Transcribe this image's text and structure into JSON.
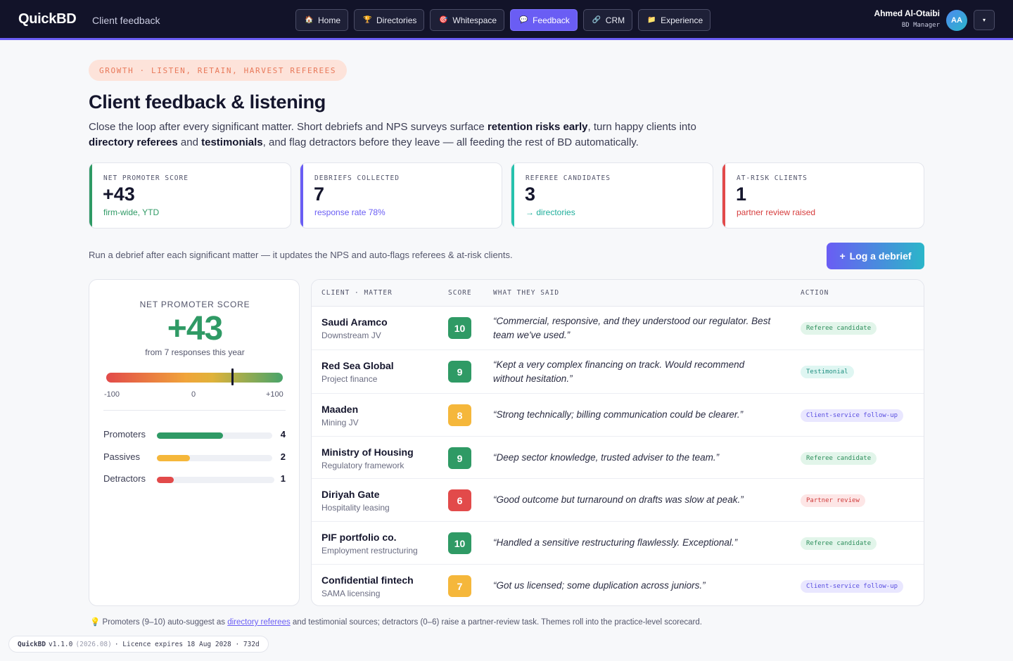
{
  "header": {
    "brand": "QuickBD",
    "section": "Client feedback",
    "nav": [
      {
        "label": "Home",
        "icon": "🏠",
        "active": false
      },
      {
        "label": "Directories",
        "icon": "🏆",
        "active": false
      },
      {
        "label": "Whitespace",
        "icon": "🎯",
        "active": false
      },
      {
        "label": "Feedback",
        "icon": "💬",
        "active": true
      },
      {
        "label": "CRM",
        "icon": "🔗",
        "active": false
      },
      {
        "label": "Experience",
        "icon": "📁",
        "active": false
      }
    ],
    "user": {
      "name": "Ahmed Al-Otaibi",
      "role": "BD Manager",
      "initials": "AA",
      "menu_icon": "▾"
    }
  },
  "hero": {
    "eyebrow": "GROWTH · LISTEN, RETAIN, HARVEST REFEREES",
    "title": "Client feedback & listening",
    "desc_parts": [
      {
        "t": "Close the loop after every significant matter. Short debriefs and NPS surveys surface ",
        "b": false
      },
      {
        "t": "retention risks early",
        "b": true
      },
      {
        "t": ", turn happy clients into ",
        "b": false
      },
      {
        "t": "directory referees",
        "b": true
      },
      {
        "t": " and ",
        "b": false
      },
      {
        "t": "testimonials",
        "b": true
      },
      {
        "t": ", and flag detractors before they leave — all feeding the rest of BD automatically.",
        "b": false
      }
    ]
  },
  "kpis": [
    {
      "label": "NET PROMOTER SCORE",
      "value": "+43",
      "sub": "firm-wide, YTD",
      "tone": "green"
    },
    {
      "label": "DEBRIEFS COLLECTED",
      "value": "7",
      "sub": "response rate 78%",
      "tone": "purple"
    },
    {
      "label": "REFEREE CANDIDATES",
      "value": "3",
      "sub": "→ directories",
      "tone": "teal"
    },
    {
      "label": "AT-RISK CLIENTS",
      "value": "1",
      "sub": "partner review raised",
      "tone": "red"
    }
  ],
  "actions": {
    "hint": "Run a debrief after each significant matter — it updates the NPS and auto-flags referees & at-risk clients.",
    "log_button": "Log a debrief",
    "log_icon": "+"
  },
  "nps": {
    "label": "NET PROMOTER SCORE",
    "score": "+43",
    "score_value": 43,
    "responses": "from 7 responses this year",
    "min": -100,
    "max": 100,
    "ticks": [
      "-100",
      "0",
      "+100"
    ],
    "distribution": [
      {
        "label": "Promoters",
        "count": 4,
        "color": "#2f9a65"
      },
      {
        "label": "Passives",
        "count": 2,
        "color": "#f5b73b"
      },
      {
        "label": "Detractors",
        "count": 1,
        "color": "#e24a4a"
      }
    ],
    "distribution_total": 7
  },
  "table": {
    "headers": {
      "client": "CLIENT · MATTER",
      "score": "SCORE",
      "said": "WHAT THEY SAID",
      "action": "ACTION"
    },
    "rows": [
      {
        "client": "Saudi Aramco",
        "matter": "Downstream JV",
        "score": "10",
        "quote": "“Commercial, responsive, and they understood our regulator. Best team we've used.”",
        "action": "Referee candidate",
        "tone": "referee"
      },
      {
        "client": "Red Sea Global",
        "matter": "Project finance",
        "score": "9",
        "quote": "“Kept a very complex financing on track. Would recommend without hesitation.”",
        "action": "Testimonial",
        "tone": "testimonial"
      },
      {
        "client": "Maaden",
        "matter": "Mining JV",
        "score": "8",
        "quote": "“Strong technically; billing communication could be clearer.”",
        "action": "Client-service follow-up",
        "tone": "followup"
      },
      {
        "client": "Ministry of Housing",
        "matter": "Regulatory framework",
        "score": "9",
        "quote": "“Deep sector knowledge, trusted adviser to the team.”",
        "action": "Referee candidate",
        "tone": "referee"
      },
      {
        "client": "Diriyah Gate",
        "matter": "Hospitality leasing",
        "score": "6",
        "quote": "“Good outcome but turnaround on drafts was slow at peak.”",
        "action": "Partner review",
        "tone": "partner"
      },
      {
        "client": "PIF portfolio co.",
        "matter": "Employment restructuring",
        "score": "10",
        "quote": "“Handled a sensitive restructuring flawlessly. Exceptional.”",
        "action": "Referee candidate",
        "tone": "referee"
      },
      {
        "client": "Confidential fintech",
        "matter": "SAMA licensing",
        "score": "7",
        "quote": "“Got us licensed; some duplication across juniors.”",
        "action": "Client-service follow-up",
        "tone": "followup"
      }
    ]
  },
  "footer": {
    "note_icon": "💡",
    "note_before": "Promoters (9–10) auto-suggest as ",
    "note_link": "directory referees",
    "note_after": " and testimonial sources; detractors (0–6) raise a partner-review task. Themes roll into the practice-level scorecard.",
    "version_app": "QuickBD",
    "version_num": "v1.1.0",
    "version_build": "(2026.08)",
    "version_licence": "· Licence expires 18 Aug 2028 · 732d"
  },
  "colors": {
    "accent": "#6a5df4",
    "promoter": "#2f9a65",
    "passive": "#f5b73b",
    "detractor": "#e24a4a"
  }
}
